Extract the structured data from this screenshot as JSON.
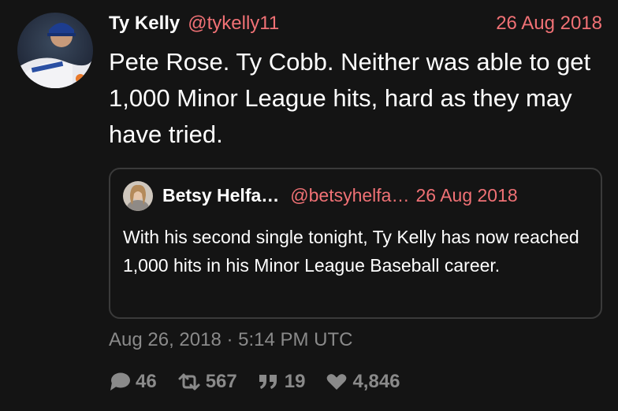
{
  "tweet": {
    "display_name": "Ty Kelly",
    "handle": "@tykelly11",
    "date": "26 Aug 2018",
    "text": "Pete Rose. Ty Cobb. Neither was able to get 1,000 Minor League hits, hard as they may have tried.",
    "timestamp": "Aug 26, 2018 · 5:14 PM UTC"
  },
  "quoted_tweet": {
    "display_name": "Betsy Helfa…",
    "handle": "@betsyhelfa…",
    "date": "26 Aug 2018",
    "text": "With his second single tonight, Ty Kelly has now reached 1,000 hits in his Minor League Baseball career."
  },
  "stats": {
    "replies": "46",
    "retweets": "567",
    "quotes": "19",
    "likes": "4,846"
  },
  "icons": {
    "reply": "comment-icon",
    "retweet": "retweet-icon",
    "quote": "quote-icon",
    "like": "heart-icon"
  },
  "colors": {
    "background": "#141414",
    "accent": "#f07175",
    "muted": "#8a8a8a",
    "border": "#3a3a3a"
  }
}
